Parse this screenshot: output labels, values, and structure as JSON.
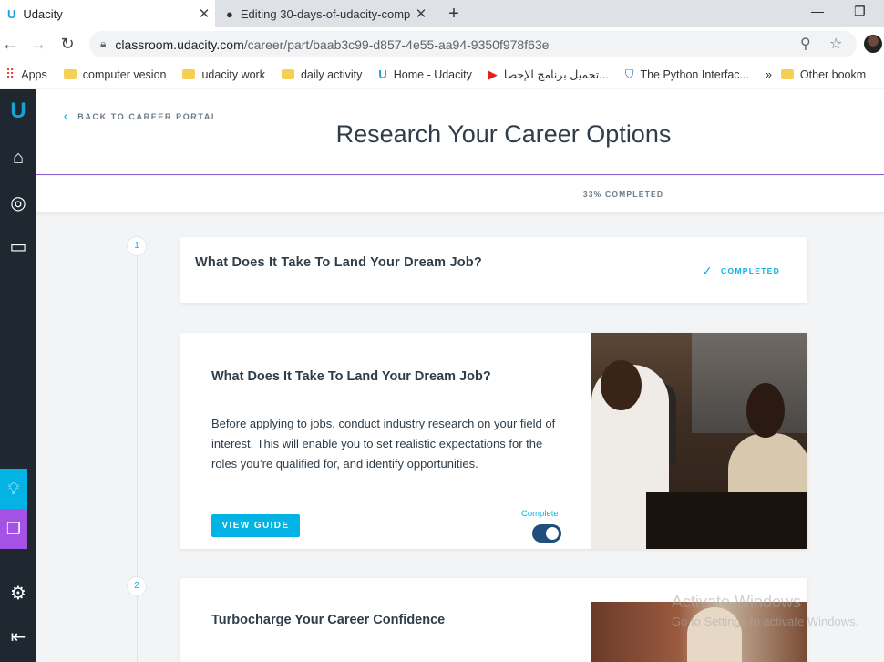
{
  "browser": {
    "tabs": [
      {
        "title": "Udacity",
        "active": true
      },
      {
        "title": "Editing 30-days-of-udacity-comp",
        "active": false
      }
    ],
    "url_domain": "classroom.udacity.com",
    "url_path": "/career/part/baab3c99-d857-4e55-aa94-9350f978f63e",
    "bookmarks": [
      {
        "label": "Apps",
        "icon": "apps-icon"
      },
      {
        "label": "computer vesion",
        "icon": "folder-icon"
      },
      {
        "label": "udacity work",
        "icon": "folder-icon"
      },
      {
        "label": "daily activity",
        "icon": "folder-icon"
      },
      {
        "label": "Home - Udacity",
        "icon": "udacity-icon"
      },
      {
        "label": "تحميل برنامج الإحصا...",
        "icon": "youtube-icon"
      },
      {
        "label": "The Python Interfac...",
        "icon": "shield-icon"
      },
      {
        "label": "Other bookm",
        "icon": "folder-icon"
      }
    ]
  },
  "header": {
    "back_label": "BACK TO CAREER PORTAL",
    "title": "Research Your Career Options",
    "progress": "33% COMPLETED"
  },
  "steps": [
    {
      "number": "1",
      "summary_title": "What Does It Take To Land Your Dream Job?",
      "status": "COMPLETED",
      "title": "What Does It Take To Land Your Dream Job?",
      "description": "Before applying to jobs, conduct industry research on your field of interest. This will enable you to set realistic expectations for the roles you’re qualified for, and identify opportunities.",
      "button": "VIEW GUIDE",
      "toggle_label": "Complete",
      "toggle_on": true
    },
    {
      "number": "2",
      "title": "Turbocharge Your Career Confidence"
    }
  ],
  "watermark": {
    "line1": "Activate Windows",
    "line2": "Go to Settings to activate Windows."
  },
  "colors": {
    "accent": "#02b3e4",
    "sidebar": "#1f2730",
    "purple": "#8a63d2",
    "toggle": "#1f4f7a"
  }
}
